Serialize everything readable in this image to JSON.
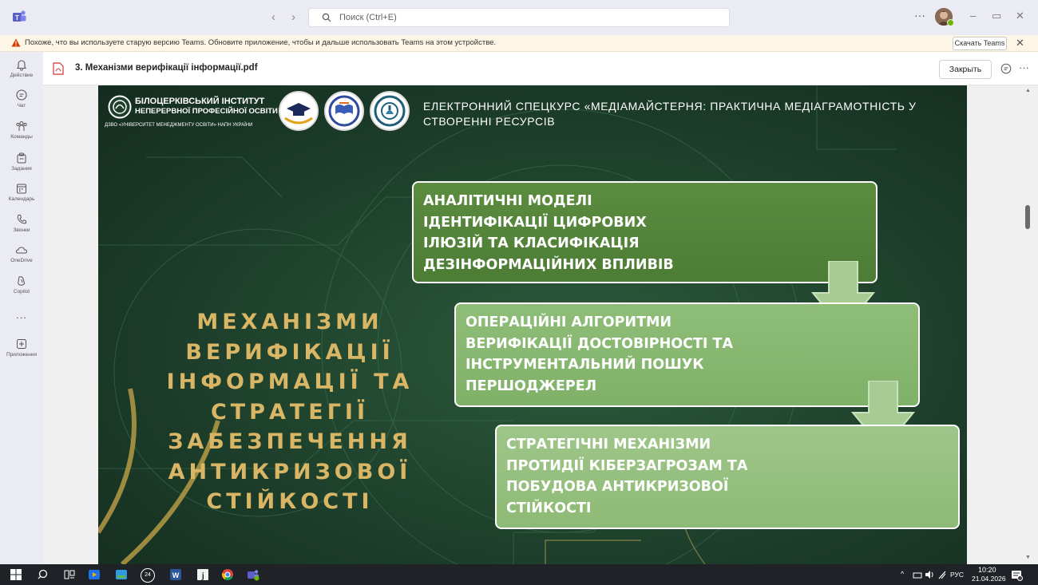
{
  "search": {
    "placeholder": "Поиск (Ctrl+E)"
  },
  "warning": {
    "text": "Похоже, что вы используете старую версию Teams. Обновите приложение, чтобы и дальше использовать Teams на этом устройстве.",
    "download_label": "Скачать Teams"
  },
  "rail": {
    "items": [
      {
        "label": "Действие",
        "icon": "bell-icon"
      },
      {
        "label": "Чат",
        "icon": "chat-icon"
      },
      {
        "label": "Команды",
        "icon": "teams-icon"
      },
      {
        "label": "Задания",
        "icon": "assignments-icon"
      },
      {
        "label": "Календарь",
        "icon": "calendar-icon"
      },
      {
        "label": "Звонки",
        "icon": "phone-icon"
      },
      {
        "label": "OneDrive",
        "icon": "onedrive-icon"
      },
      {
        "label": "Copilot",
        "icon": "copilot-icon"
      },
      {
        "label": "...",
        "icon": "more-icon"
      },
      {
        "label": "Приложения",
        "icon": "apps-icon"
      }
    ]
  },
  "document": {
    "title": "3. Механізми верифікації інформації.pdf",
    "close_label": "Закрыть"
  },
  "slide": {
    "institute_line1": "БІЛОЦЕРКІВСЬКИЙ ІНСТИТУТ",
    "institute_line2": "НЕПЕРЕРВНОЇ ПРОФЕСІЙНОЇ ОСВІТИ",
    "institute_line3": "ДЗВО «УНІВЕРСИТЕТ МЕНЕДЖМЕНТУ ОСВІТИ» НАПН УКРАЇНИ",
    "course_title": "ЕЛЕКТРОННИЙ СПЕЦКУРС «МЕДІАМАЙСТЕРНЯ: ПРАКТИЧНА МЕДІАГРАМОТНІСТЬ У СТВОРЕННІ РЕСУРСІВ",
    "main_title_lines": [
      "МЕХАНІЗМИ",
      "ВЕРИФІКАЦІЇ",
      "ІНФОРМАЦІЇ ТА",
      "СТРАТЕГІЇ",
      "ЗАБЕЗПЕЧЕННЯ",
      "АНТИКРИЗОВОЇ",
      "СТІЙКОСТІ"
    ],
    "boxes": [
      {
        "lines": [
          "АНАЛІТИЧНІ МОДЕЛІ",
          "ІДЕНТИФІКАЦІЇ ЦИФРОВИХ",
          "ІЛЮЗІЙ ТА КЛАСИФІКАЦІЯ",
          "ДЕЗІНФОРМАЦІЙНИХ ВПЛИВІВ"
        ]
      },
      {
        "lines": [
          "ОПЕРАЦІЙНІ АЛГОРИТМИ",
          "ВЕРИФІКАЦІЇ ДОСТОВІРНОСТІ ТА",
          "ІНСТРУМЕНТАЛЬНИЙ ПОШУК",
          "ПЕРШОДЖЕРЕЛ"
        ]
      },
      {
        "lines": [
          "СТРАТЕГІЧНІ МЕХАНІЗМИ",
          "ПРОТИДІЇ КІБЕРЗАГРОЗАМ ТА",
          "ПОБУДОВА АНТИКРИЗОВОЇ",
          "СТІЙКОСТІ"
        ]
      }
    ]
  },
  "taskbar": {
    "language": "РУС",
    "time": "10:20",
    "date": "21.04.2026",
    "badge": "24"
  },
  "colors": {
    "slide_bg": "#1d3f2b",
    "title_gold": "#d9b665",
    "box1": "#5b8c3f",
    "box2": "#8ebd78",
    "box3": "#9fc68a",
    "teams_accent": "#5b5fc7"
  }
}
